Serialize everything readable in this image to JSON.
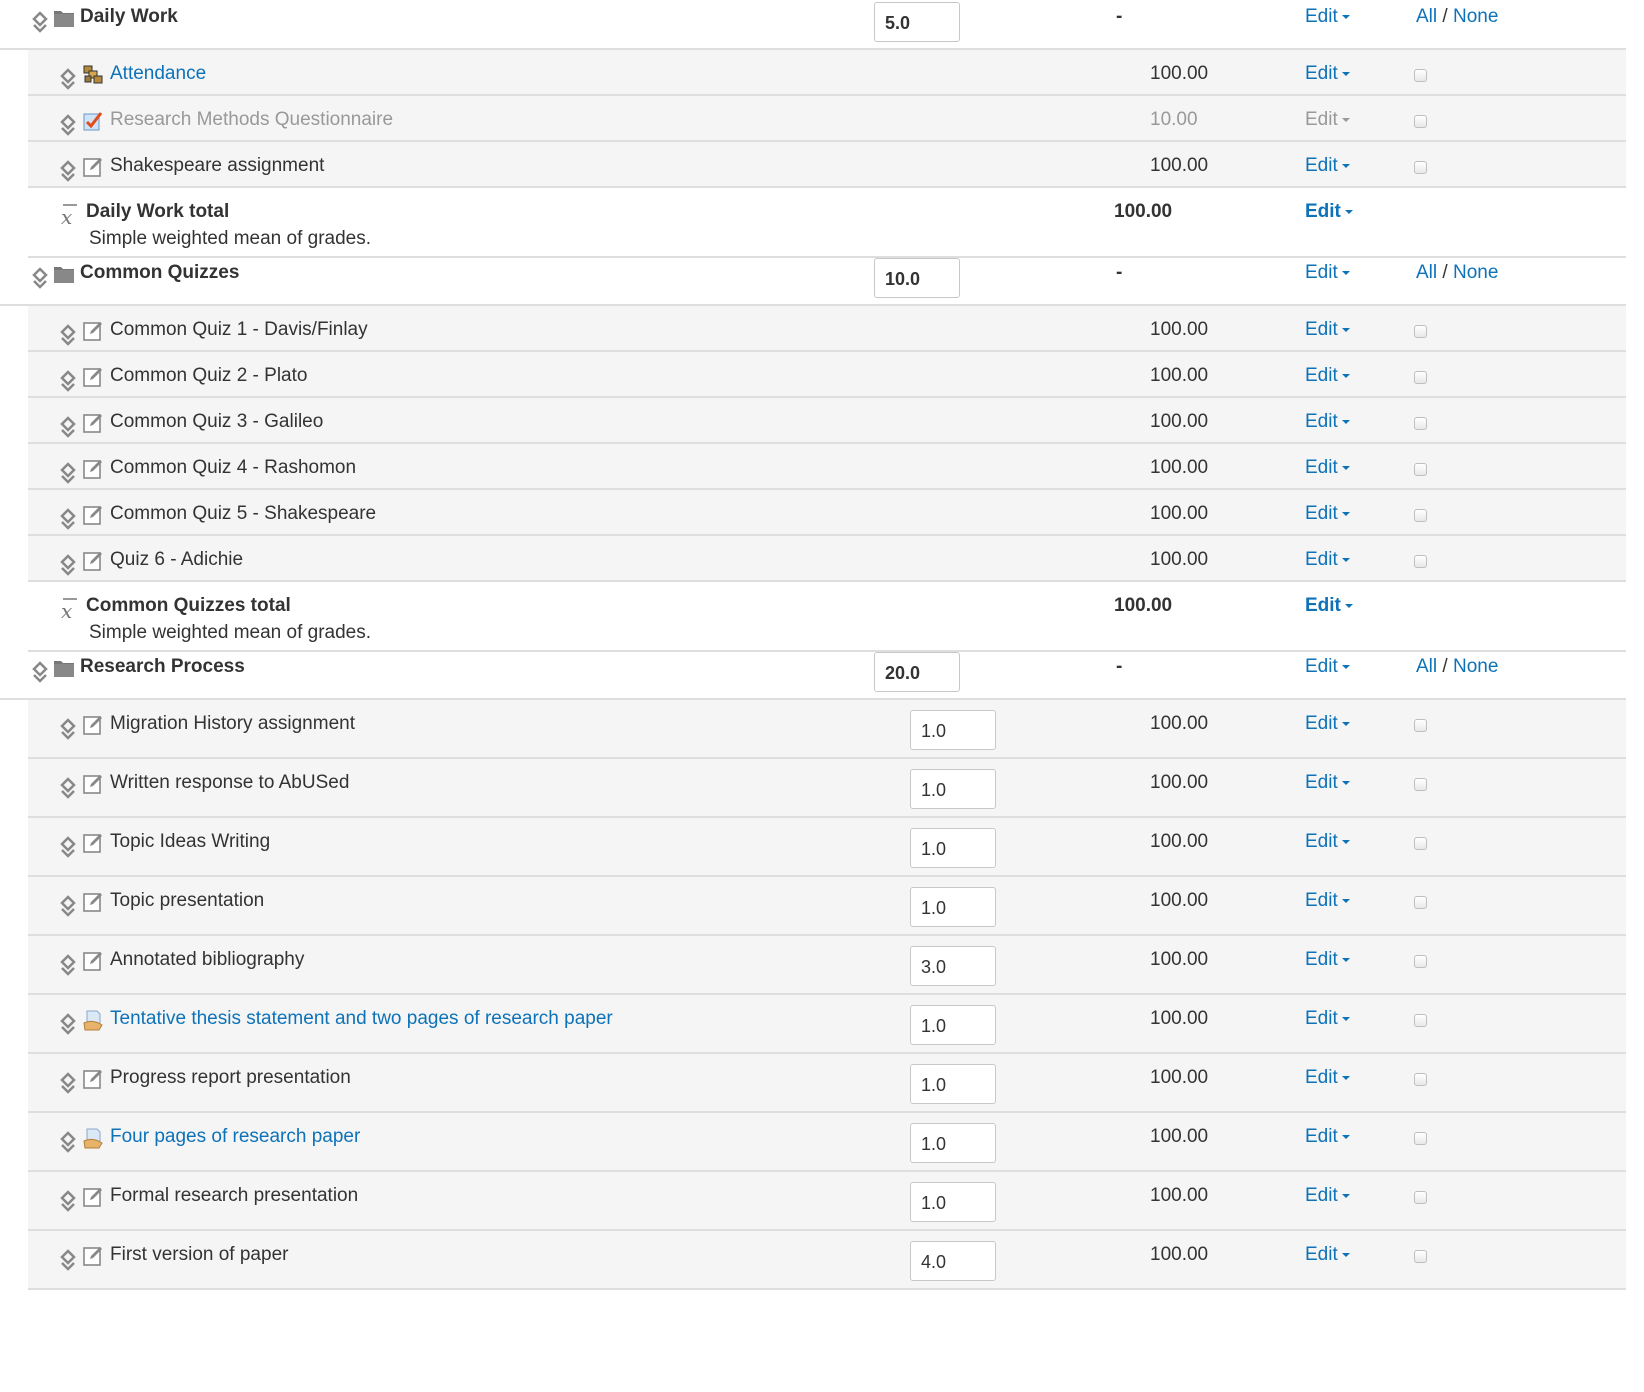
{
  "colors": {
    "link": "#0d72b8",
    "muted": "#999999",
    "row_bg": "#f5f5f5",
    "border": "#dedede"
  },
  "rows": [
    {
      "type": "category",
      "name": "Daily Work",
      "weight": "5.0",
      "grade": "-",
      "edit": "Edit",
      "all": "All",
      "sep": "/",
      "none": "None",
      "icon": "folder-icon"
    },
    {
      "type": "item",
      "name": "Attendance",
      "grade": "100.00",
      "edit": "Edit",
      "icon": "attendance-icon",
      "style": "link"
    },
    {
      "type": "item",
      "name": "Research Methods Questionnaire",
      "grade": "10.00",
      "edit": "Edit",
      "icon": "questionnaire-icon",
      "style": "hidden"
    },
    {
      "type": "item",
      "name": "Shakespeare assignment",
      "grade": "100.00",
      "edit": "Edit",
      "icon": "manual-item-icon",
      "style": "normal"
    },
    {
      "type": "total",
      "name": "Daily Work total",
      "sub": "Simple weighted mean of grades.",
      "grade": "100.00",
      "edit": "Edit",
      "icon": "mean-icon"
    },
    {
      "type": "category",
      "name": "Common Quizzes",
      "weight": "10.0",
      "grade": "-",
      "edit": "Edit",
      "all": "All",
      "sep": "/",
      "none": "None",
      "icon": "folder-icon"
    },
    {
      "type": "item",
      "name": "Common Quiz 1 - Davis/Finlay",
      "grade": "100.00",
      "edit": "Edit",
      "icon": "manual-item-icon",
      "style": "normal"
    },
    {
      "type": "item",
      "name": "Common Quiz 2 - Plato",
      "grade": "100.00",
      "edit": "Edit",
      "icon": "manual-item-icon",
      "style": "normal"
    },
    {
      "type": "item",
      "name": "Common Quiz 3 - Galileo",
      "grade": "100.00",
      "edit": "Edit",
      "icon": "manual-item-icon",
      "style": "normal"
    },
    {
      "type": "item",
      "name": "Common Quiz 4 - Rashomon",
      "grade": "100.00",
      "edit": "Edit",
      "icon": "manual-item-icon",
      "style": "normal"
    },
    {
      "type": "item",
      "name": "Common Quiz 5 - Shakespeare",
      "grade": "100.00",
      "edit": "Edit",
      "icon": "manual-item-icon",
      "style": "normal"
    },
    {
      "type": "item",
      "name": "Quiz 6 - Adichie",
      "grade": "100.00",
      "edit": "Edit",
      "icon": "manual-item-icon",
      "style": "normal"
    },
    {
      "type": "total",
      "name": "Common Quizzes total",
      "sub": "Simple weighted mean of grades.",
      "grade": "100.00",
      "edit": "Edit",
      "icon": "mean-icon"
    },
    {
      "type": "category",
      "name": "Research Process",
      "weight": "20.0",
      "grade": "-",
      "edit": "Edit",
      "all": "All",
      "sep": "/",
      "none": "None",
      "icon": "folder-icon"
    },
    {
      "type": "witem",
      "name": "Migration History assignment",
      "weight": "1.0",
      "grade": "100.00",
      "edit": "Edit",
      "icon": "manual-item-icon",
      "style": "normal"
    },
    {
      "type": "witem",
      "name": "Written response to AbUSed",
      "weight": "1.0",
      "grade": "100.00",
      "edit": "Edit",
      "icon": "manual-item-icon",
      "style": "normal"
    },
    {
      "type": "witem",
      "name": "Topic Ideas Writing",
      "weight": "1.0",
      "grade": "100.00",
      "edit": "Edit",
      "icon": "manual-item-icon",
      "style": "normal"
    },
    {
      "type": "witem",
      "name": "Topic presentation",
      "weight": "1.0",
      "grade": "100.00",
      "edit": "Edit",
      "icon": "manual-item-icon",
      "style": "normal"
    },
    {
      "type": "witem",
      "name": "Annotated bibliography",
      "weight": "3.0",
      "grade": "100.00",
      "edit": "Edit",
      "icon": "manual-item-icon",
      "style": "normal"
    },
    {
      "type": "witem",
      "name": "Tentative thesis statement and two pages of research paper",
      "weight": "1.0",
      "grade": "100.00",
      "edit": "Edit",
      "icon": "assignment-icon",
      "style": "link"
    },
    {
      "type": "witem",
      "name": "Progress report presentation",
      "weight": "1.0",
      "grade": "100.00",
      "edit": "Edit",
      "icon": "manual-item-icon",
      "style": "normal"
    },
    {
      "type": "witem",
      "name": "Four pages of research paper",
      "weight": "1.0",
      "grade": "100.00",
      "edit": "Edit",
      "icon": "assignment-icon",
      "style": "link"
    },
    {
      "type": "witem",
      "name": "Formal research presentation",
      "weight": "1.0",
      "grade": "100.00",
      "edit": "Edit",
      "icon": "manual-item-icon",
      "style": "normal"
    },
    {
      "type": "witem",
      "name": "First version of paper",
      "weight": "4.0",
      "grade": "100.00",
      "edit": "Edit",
      "icon": "manual-item-icon",
      "style": "normal"
    }
  ]
}
